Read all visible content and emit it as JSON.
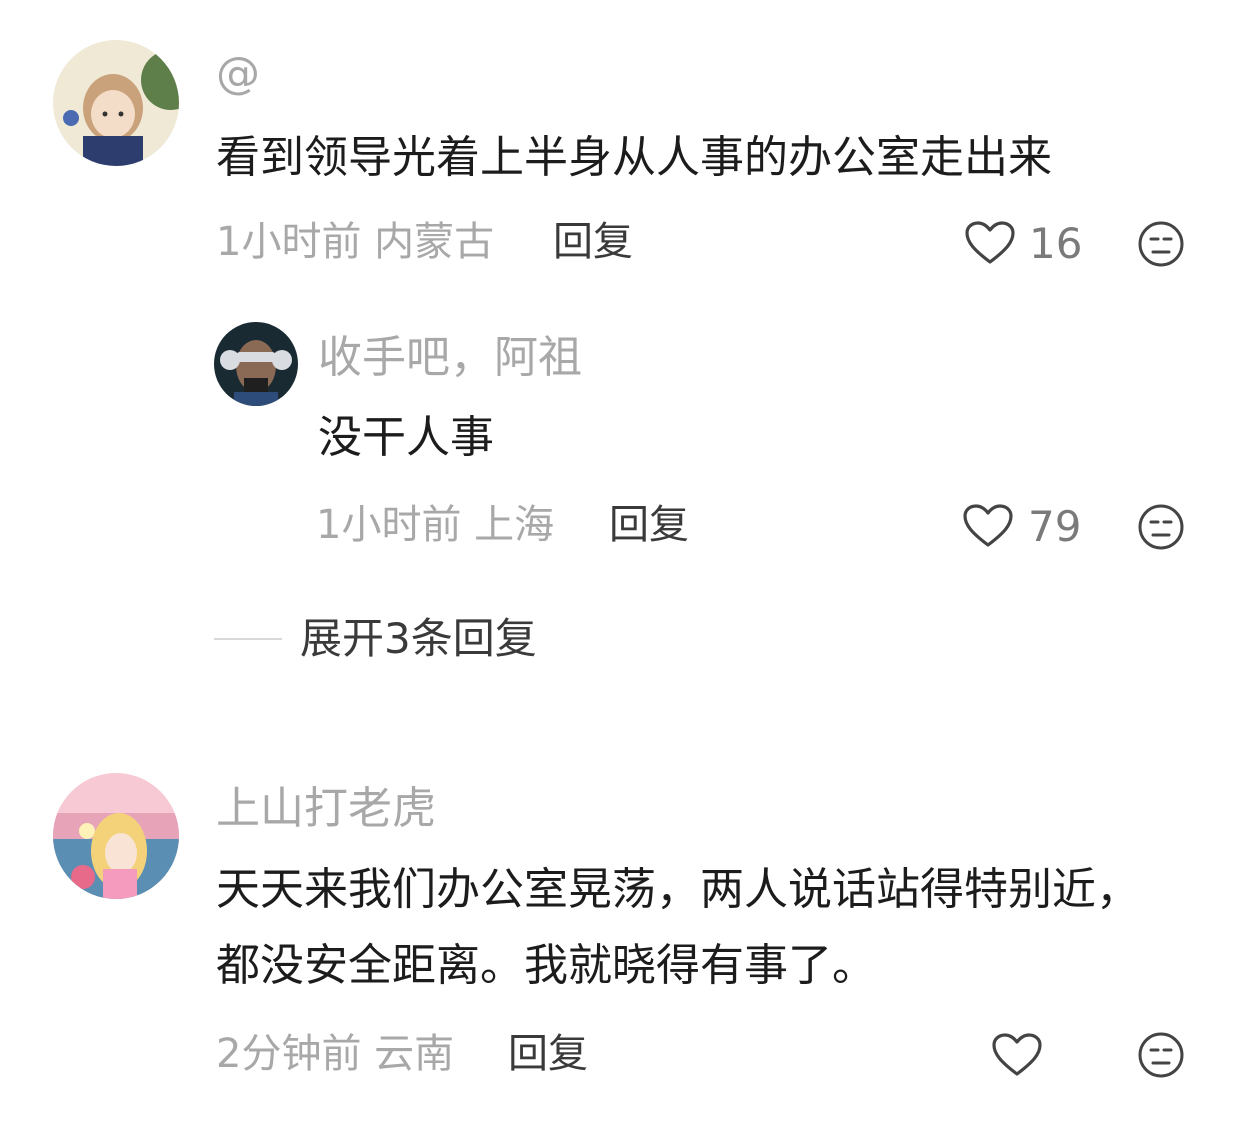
{
  "comments": [
    {
      "username": "@",
      "content": "看到领导光着上半身从人事的办公室走出来",
      "time_location": "1小时前 内蒙古",
      "reply_label": "回复",
      "likes": "16",
      "replies": [
        {
          "username": "收手吧，阿祖",
          "content": "没干人事",
          "time_location": "1小时前 上海",
          "reply_label": "回复",
          "likes": "79"
        }
      ],
      "expand_label": "展开3条回复"
    },
    {
      "username": "上山打老虎",
      "content": "天天来我们办公室晃荡，两人说话站得特别近，都没安全距离。我就晓得有事了。",
      "time_location": "2分钟前 云南",
      "reply_label": "回复",
      "likes": ""
    }
  ],
  "icons": {
    "like": "heart-outline-icon",
    "dislike": "neutral-face-icon"
  },
  "colors": {
    "text_primary": "#1c1c1c",
    "text_secondary": "#a8a8a8",
    "reply_text": "#3a3a3a"
  }
}
